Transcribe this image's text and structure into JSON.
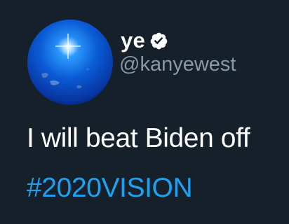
{
  "user": {
    "display_name": "ye",
    "handle": "@kanyewest",
    "verified": true,
    "avatar_icon": "blue-globe-avatar"
  },
  "tweet": {
    "text_line": "I will beat Biden off",
    "hashtag": "#2020VISION"
  },
  "colors": {
    "background": "#15202b",
    "text": "#ffffff",
    "handle": "#8899a6",
    "hashtag": "#1da1f2",
    "verified_badge": "#ffffff"
  },
  "icons": {
    "verified": "verified-badge-icon"
  }
}
